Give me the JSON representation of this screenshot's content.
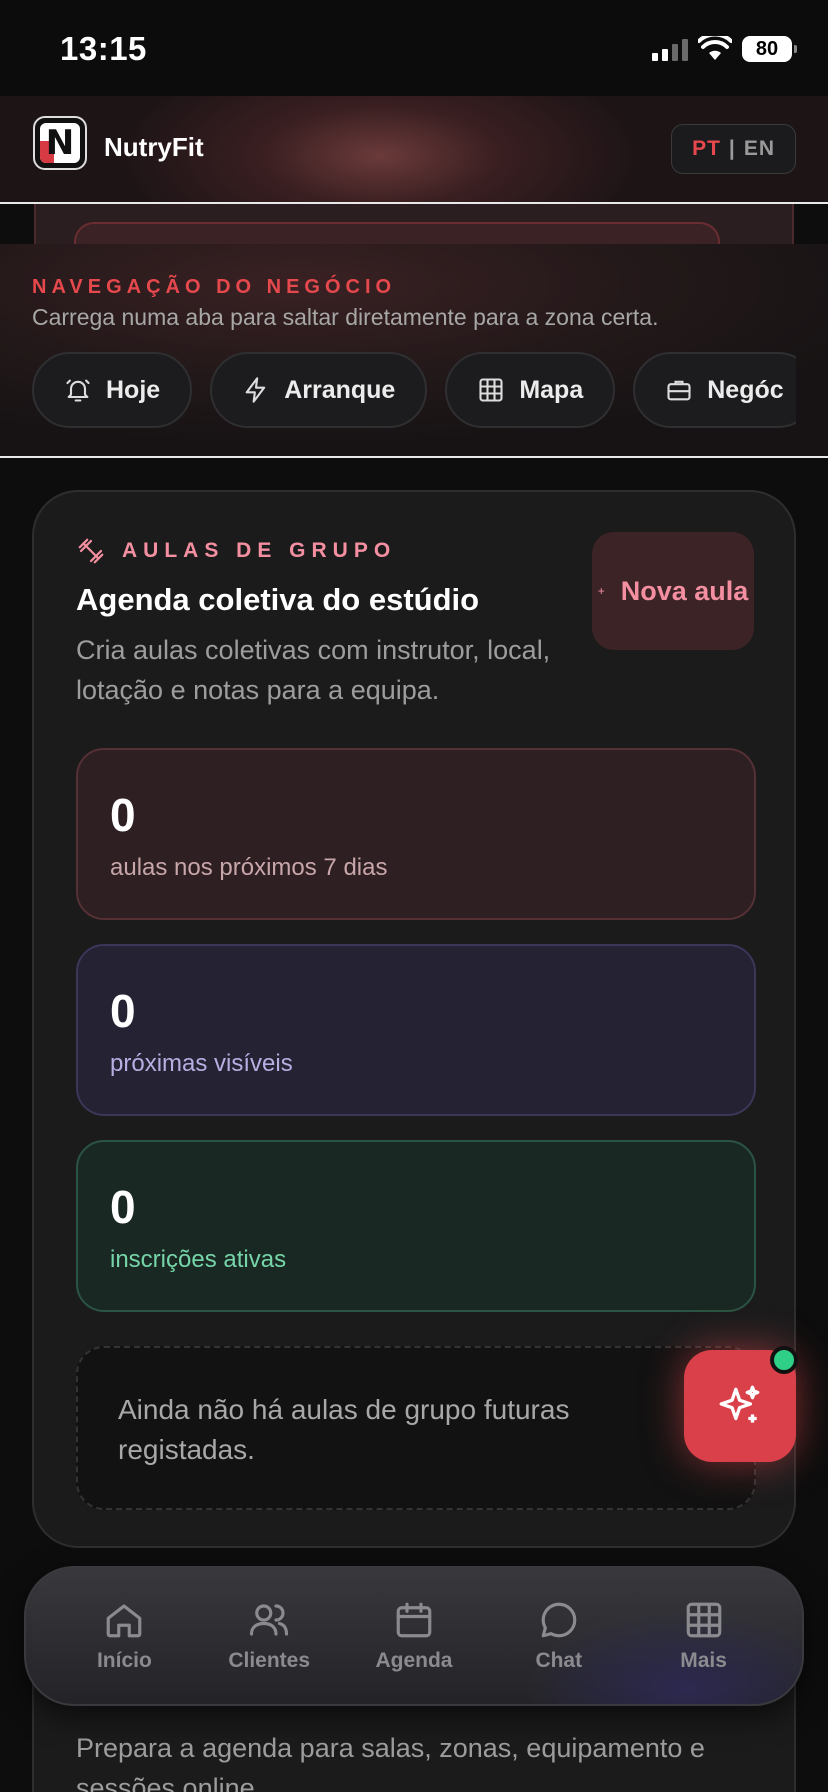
{
  "status_bar": {
    "time": "13:15",
    "battery": "80"
  },
  "header": {
    "app_name": "NutryFit",
    "logo_letter": "N",
    "lang_active": "PT",
    "lang_sep": "|",
    "lang_other": "EN"
  },
  "business_nav": {
    "overline": "NAVEGAÇÃO DO NEGÓCIO",
    "hint": "Carrega numa aba para saltar diretamente para a zona certa.",
    "chips": [
      {
        "label": "Hoje",
        "icon": "bell-icon"
      },
      {
        "label": "Arranque",
        "icon": "bolt-icon"
      },
      {
        "label": "Mapa",
        "icon": "grid-icon"
      },
      {
        "label": "Negóc",
        "icon": "briefcase-icon"
      }
    ]
  },
  "group_classes": {
    "overline": "AULAS DE GRUPO",
    "title": "Agenda coletiva do estúdio",
    "description": "Cria aulas coletivas com instrutor, local, lotação e notas para a equipa.",
    "new_button": "Nova aula",
    "stats": [
      {
        "value": "0",
        "label": "aulas nos próximos 7 dias"
      },
      {
        "value": "0",
        "label": "próximas visíveis"
      },
      {
        "value": "0",
        "label": "inscrições ativas"
      }
    ],
    "empty_message": "Ainda não há aulas de grupo futuras registadas."
  },
  "next_section": {
    "description": "Prepara a agenda para salas, zonas, equipamento e sessões online."
  },
  "tab_bar": {
    "tabs": [
      {
        "label": "Início",
        "icon": "home-icon"
      },
      {
        "label": "Clientes",
        "icon": "users-icon"
      },
      {
        "label": "Agenda",
        "icon": "calendar-icon"
      },
      {
        "label": "Chat",
        "icon": "chat-icon"
      },
      {
        "label": "Mais",
        "icon": "grid-icon"
      }
    ]
  },
  "colors": {
    "accent": "#e5484d",
    "pink": "#f38fa0",
    "green": "#2fcf88",
    "purple": "#b8aee2"
  }
}
